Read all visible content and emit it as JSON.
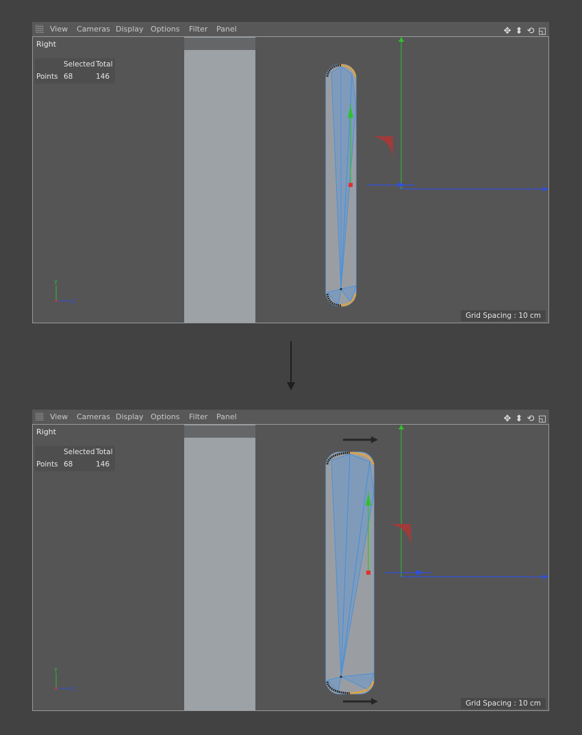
{
  "menu": [
    "View",
    "Cameras",
    "Display",
    "Options",
    "Filter",
    "Panel"
  ],
  "nav_icons": [
    "move-view-icon",
    "zoom-view-icon",
    "rotate-view-icon",
    "maximize-view-icon"
  ],
  "viewport": {
    "title": "Right",
    "hud": {
      "col_selected": "Selected",
      "col_total": "Total",
      "row_label": "Points",
      "selected": "68",
      "total": "146"
    },
    "grid_spacing": "Grid Spacing : 10 cm",
    "axis_y": "Y",
    "axis_z": "Z"
  },
  "colors": {
    "background": "#424242",
    "viewport_bg": "#555555",
    "object_fill": "#999999",
    "wireframe": "#4a90d9",
    "selected_points": "#f5a623",
    "axis_x": "#e03030",
    "axis_y": "#30c030",
    "axis_z": "#3050e0"
  }
}
